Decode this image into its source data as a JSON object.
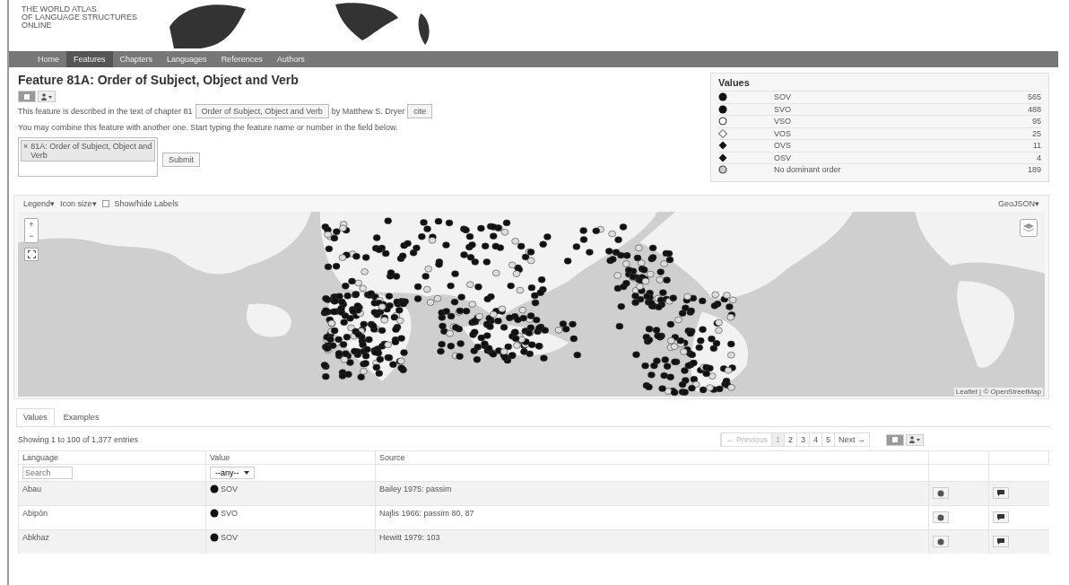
{
  "header": {
    "logo_lines": [
      "THE WORLD ATLAS",
      "OF LANGUAGE STRUCTURES",
      "ONLINE"
    ]
  },
  "nav": [
    {
      "label": "Home",
      "selected": false
    },
    {
      "label": "Features",
      "selected": true
    },
    {
      "label": "Chapters",
      "selected": false
    },
    {
      "label": "Languages",
      "selected": false
    },
    {
      "label": "References",
      "selected": false
    },
    {
      "label": "Authors",
      "selected": false
    }
  ],
  "title": "Feature 81A: Order of Subject, Object and Verb",
  "description": {
    "before": "This feature is described in the text of chapter 81",
    "chapter_button": "Order of Subject, Object and Verb",
    "after": "by Matthew S. Dryer",
    "cite_button": "cite"
  },
  "combine": {
    "hint": "You may combine this feature with another one. Start typing the feature name or number in the field below.",
    "token_remove": "×",
    "token": "81A: Order of Subject, Object and Verb",
    "submit": "Submit"
  },
  "values_panel": {
    "title": "Values",
    "items": [
      {
        "kind": "dot",
        "label": "SOV",
        "count": "565"
      },
      {
        "kind": "dot",
        "label": "SVO",
        "count": "488"
      },
      {
        "kind": "ring",
        "label": "VSO",
        "count": "95"
      },
      {
        "kind": "open-diamond",
        "label": "VOS",
        "count": "25"
      },
      {
        "kind": "diamond",
        "label": "OVS",
        "count": "11"
      },
      {
        "kind": "diamond",
        "label": "OSV",
        "count": "4"
      },
      {
        "kind": "double-ring",
        "label": "No dominant order",
        "count": "189"
      }
    ]
  },
  "map_toolbar": {
    "legend": "Legend▾",
    "icon_size": "Icon size▾",
    "labels_checkbox": {
      "label": "Show/hide Labels",
      "checked": false
    },
    "geojson": "GeoJSON▾"
  },
  "map_controls": {
    "zoom_in": "+",
    "zoom_out": "−"
  },
  "attribution": "Leaflet | © OpenStreetMap",
  "tabs": [
    {
      "label": "Values",
      "selected": true
    },
    {
      "label": "Examples",
      "selected": false
    }
  ],
  "table": {
    "info": "Showing 1 to 100 of 1,377 entries",
    "pagination": [
      {
        "label": "← Previous",
        "selected": false,
        "disabled": true
      },
      {
        "label": "1",
        "selected": true,
        "disabled": false
      },
      {
        "label": "2",
        "selected": false,
        "disabled": false
      },
      {
        "label": "3",
        "selected": false,
        "disabled": false
      },
      {
        "label": "4",
        "selected": false,
        "disabled": false
      },
      {
        "label": "5",
        "selected": false,
        "disabled": false
      },
      {
        "label": "Next →",
        "selected": false,
        "disabled": false
      }
    ],
    "columns": [
      "Language",
      "Value",
      "Source"
    ],
    "search_placeholder": "Search",
    "value_filter": "--any--",
    "rows": [
      {
        "language": "Abau",
        "value": {
          "kind": "dot",
          "label": "SOV"
        },
        "source": "Bailey 1975: passim"
      },
      {
        "language": "Abipón",
        "value": {
          "kind": "dot",
          "label": "SVO"
        },
        "source": "Najlis 1966: passim 80, 87"
      },
      {
        "language": "Abkhaz",
        "value": {
          "kind": "dot",
          "label": "SOV"
        },
        "source": "Hewitt 1979: 103"
      }
    ]
  }
}
